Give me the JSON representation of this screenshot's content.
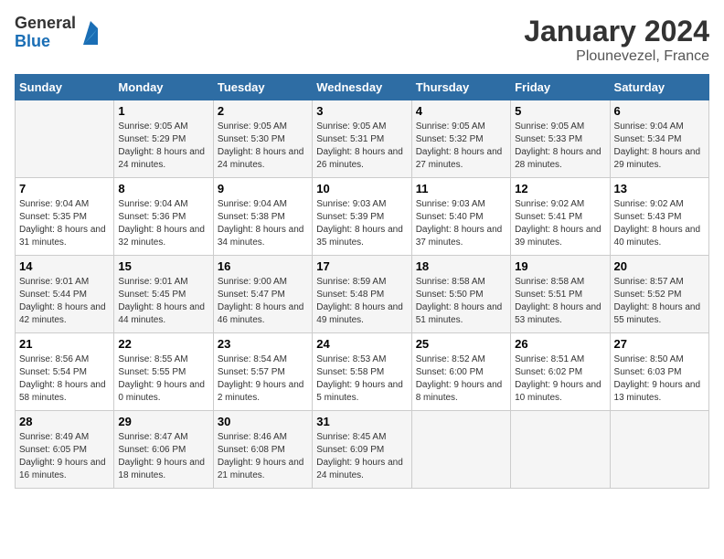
{
  "logo": {
    "general": "General",
    "blue": "Blue"
  },
  "title": "January 2024",
  "subtitle": "Plounevezel, France",
  "headers": [
    "Sunday",
    "Monday",
    "Tuesday",
    "Wednesday",
    "Thursday",
    "Friday",
    "Saturday"
  ],
  "weeks": [
    [
      {
        "day": "",
        "sunrise": "",
        "sunset": "",
        "daylight": ""
      },
      {
        "day": "1",
        "sunrise": "Sunrise: 9:05 AM",
        "sunset": "Sunset: 5:29 PM",
        "daylight": "Daylight: 8 hours and 24 minutes."
      },
      {
        "day": "2",
        "sunrise": "Sunrise: 9:05 AM",
        "sunset": "Sunset: 5:30 PM",
        "daylight": "Daylight: 8 hours and 24 minutes."
      },
      {
        "day": "3",
        "sunrise": "Sunrise: 9:05 AM",
        "sunset": "Sunset: 5:31 PM",
        "daylight": "Daylight: 8 hours and 26 minutes."
      },
      {
        "day": "4",
        "sunrise": "Sunrise: 9:05 AM",
        "sunset": "Sunset: 5:32 PM",
        "daylight": "Daylight: 8 hours and 27 minutes."
      },
      {
        "day": "5",
        "sunrise": "Sunrise: 9:05 AM",
        "sunset": "Sunset: 5:33 PM",
        "daylight": "Daylight: 8 hours and 28 minutes."
      },
      {
        "day": "6",
        "sunrise": "Sunrise: 9:04 AM",
        "sunset": "Sunset: 5:34 PM",
        "daylight": "Daylight: 8 hours and 29 minutes."
      }
    ],
    [
      {
        "day": "7",
        "sunrise": "Sunrise: 9:04 AM",
        "sunset": "Sunset: 5:35 PM",
        "daylight": "Daylight: 8 hours and 31 minutes."
      },
      {
        "day": "8",
        "sunrise": "Sunrise: 9:04 AM",
        "sunset": "Sunset: 5:36 PM",
        "daylight": "Daylight: 8 hours and 32 minutes."
      },
      {
        "day": "9",
        "sunrise": "Sunrise: 9:04 AM",
        "sunset": "Sunset: 5:38 PM",
        "daylight": "Daylight: 8 hours and 34 minutes."
      },
      {
        "day": "10",
        "sunrise": "Sunrise: 9:03 AM",
        "sunset": "Sunset: 5:39 PM",
        "daylight": "Daylight: 8 hours and 35 minutes."
      },
      {
        "day": "11",
        "sunrise": "Sunrise: 9:03 AM",
        "sunset": "Sunset: 5:40 PM",
        "daylight": "Daylight: 8 hours and 37 minutes."
      },
      {
        "day": "12",
        "sunrise": "Sunrise: 9:02 AM",
        "sunset": "Sunset: 5:41 PM",
        "daylight": "Daylight: 8 hours and 39 minutes."
      },
      {
        "day": "13",
        "sunrise": "Sunrise: 9:02 AM",
        "sunset": "Sunset: 5:43 PM",
        "daylight": "Daylight: 8 hours and 40 minutes."
      }
    ],
    [
      {
        "day": "14",
        "sunrise": "Sunrise: 9:01 AM",
        "sunset": "Sunset: 5:44 PM",
        "daylight": "Daylight: 8 hours and 42 minutes."
      },
      {
        "day": "15",
        "sunrise": "Sunrise: 9:01 AM",
        "sunset": "Sunset: 5:45 PM",
        "daylight": "Daylight: 8 hours and 44 minutes."
      },
      {
        "day": "16",
        "sunrise": "Sunrise: 9:00 AM",
        "sunset": "Sunset: 5:47 PM",
        "daylight": "Daylight: 8 hours and 46 minutes."
      },
      {
        "day": "17",
        "sunrise": "Sunrise: 8:59 AM",
        "sunset": "Sunset: 5:48 PM",
        "daylight": "Daylight: 8 hours and 49 minutes."
      },
      {
        "day": "18",
        "sunrise": "Sunrise: 8:58 AM",
        "sunset": "Sunset: 5:50 PM",
        "daylight": "Daylight: 8 hours and 51 minutes."
      },
      {
        "day": "19",
        "sunrise": "Sunrise: 8:58 AM",
        "sunset": "Sunset: 5:51 PM",
        "daylight": "Daylight: 8 hours and 53 minutes."
      },
      {
        "day": "20",
        "sunrise": "Sunrise: 8:57 AM",
        "sunset": "Sunset: 5:52 PM",
        "daylight": "Daylight: 8 hours and 55 minutes."
      }
    ],
    [
      {
        "day": "21",
        "sunrise": "Sunrise: 8:56 AM",
        "sunset": "Sunset: 5:54 PM",
        "daylight": "Daylight: 8 hours and 58 minutes."
      },
      {
        "day": "22",
        "sunrise": "Sunrise: 8:55 AM",
        "sunset": "Sunset: 5:55 PM",
        "daylight": "Daylight: 9 hours and 0 minutes."
      },
      {
        "day": "23",
        "sunrise": "Sunrise: 8:54 AM",
        "sunset": "Sunset: 5:57 PM",
        "daylight": "Daylight: 9 hours and 2 minutes."
      },
      {
        "day": "24",
        "sunrise": "Sunrise: 8:53 AM",
        "sunset": "Sunset: 5:58 PM",
        "daylight": "Daylight: 9 hours and 5 minutes."
      },
      {
        "day": "25",
        "sunrise": "Sunrise: 8:52 AM",
        "sunset": "Sunset: 6:00 PM",
        "daylight": "Daylight: 9 hours and 8 minutes."
      },
      {
        "day": "26",
        "sunrise": "Sunrise: 8:51 AM",
        "sunset": "Sunset: 6:02 PM",
        "daylight": "Daylight: 9 hours and 10 minutes."
      },
      {
        "day": "27",
        "sunrise": "Sunrise: 8:50 AM",
        "sunset": "Sunset: 6:03 PM",
        "daylight": "Daylight: 9 hours and 13 minutes."
      }
    ],
    [
      {
        "day": "28",
        "sunrise": "Sunrise: 8:49 AM",
        "sunset": "Sunset: 6:05 PM",
        "daylight": "Daylight: 9 hours and 16 minutes."
      },
      {
        "day": "29",
        "sunrise": "Sunrise: 8:47 AM",
        "sunset": "Sunset: 6:06 PM",
        "daylight": "Daylight: 9 hours and 18 minutes."
      },
      {
        "day": "30",
        "sunrise": "Sunrise: 8:46 AM",
        "sunset": "Sunset: 6:08 PM",
        "daylight": "Daylight: 9 hours and 21 minutes."
      },
      {
        "day": "31",
        "sunrise": "Sunrise: 8:45 AM",
        "sunset": "Sunset: 6:09 PM",
        "daylight": "Daylight: 9 hours and 24 minutes."
      },
      {
        "day": "",
        "sunrise": "",
        "sunset": "",
        "daylight": ""
      },
      {
        "day": "",
        "sunrise": "",
        "sunset": "",
        "daylight": ""
      },
      {
        "day": "",
        "sunrise": "",
        "sunset": "",
        "daylight": ""
      }
    ]
  ]
}
